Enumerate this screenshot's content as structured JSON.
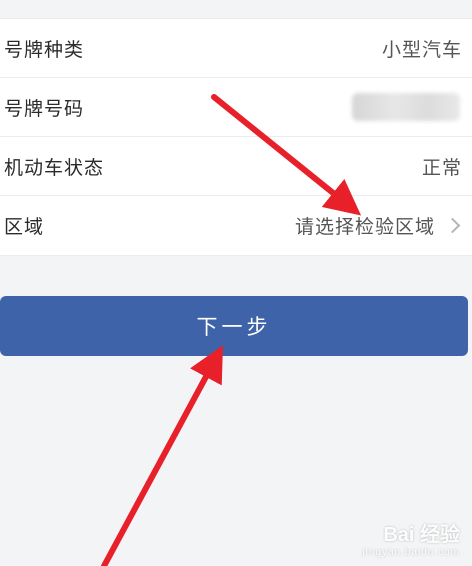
{
  "form": {
    "rows": [
      {
        "label": "号牌种类",
        "value": "小型汽车"
      },
      {
        "label": "号牌号码",
        "value": ""
      },
      {
        "label": "机动车状态",
        "value": "正常"
      },
      {
        "label": "区域",
        "value": "请选择检验区域"
      }
    ]
  },
  "next_button": {
    "label": "下一步"
  },
  "watermark": {
    "main": "Bai 经验",
    "sub": "jingyan.baidu.com"
  },
  "colors": {
    "button_bg": "#3e63a8",
    "arrow": "#e8202a",
    "page_bg": "#f3f4f6"
  },
  "icons": {
    "region_row": "chevron-right-icon",
    "annotation": "red-arrow-annotation-icon"
  }
}
